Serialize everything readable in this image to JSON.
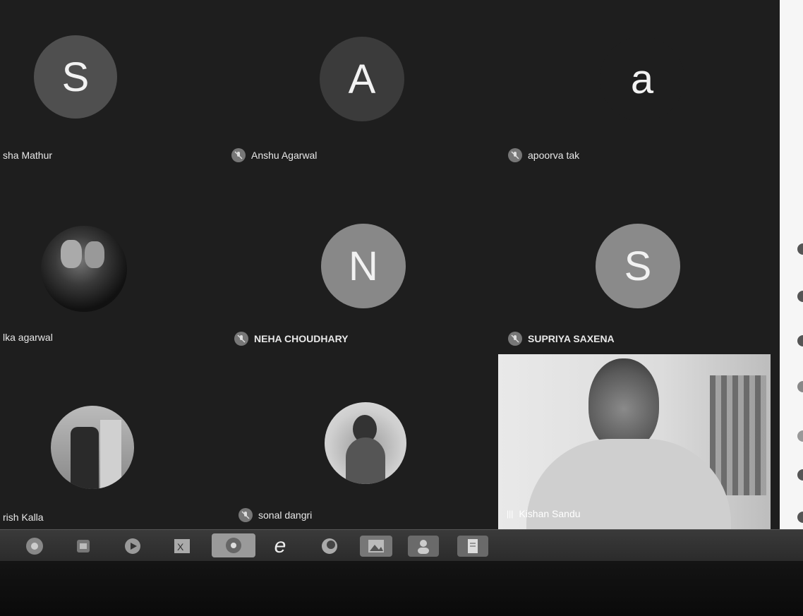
{
  "participants": [
    {
      "initial": "S",
      "name": "sha Mathur"
    },
    {
      "initial": "A",
      "name": "Anshu Agarwal"
    },
    {
      "initial": "a",
      "name": "apoorva tak"
    },
    {
      "initial": "",
      "name": "lka agarwal"
    },
    {
      "initial": "N",
      "name": "NEHA CHOUDHARY"
    },
    {
      "initial": "S",
      "name": "SUPRIYA SAXENA"
    },
    {
      "initial": "",
      "name": "rish Kalla"
    },
    {
      "initial": "",
      "name": "sonal dangri"
    },
    {
      "initial": "",
      "name": "Kishan Sandu"
    }
  ],
  "taskbar": {
    "icons": [
      "chrome-icon",
      "files-icon",
      "media-player-icon",
      "excel-icon",
      "chrome-icon",
      "internet-explorer-icon",
      "firefox-icon",
      "image-viewer-icon",
      "user-icon",
      "notepad-icon"
    ],
    "ie_glyph": "e"
  },
  "colors": {
    "background": "#1e1e1e",
    "avatar_dark": "#4a4a4a",
    "avatar_mid": "#8a8a8a",
    "taskbar": "#333333",
    "panel": "#f6f6f6"
  }
}
